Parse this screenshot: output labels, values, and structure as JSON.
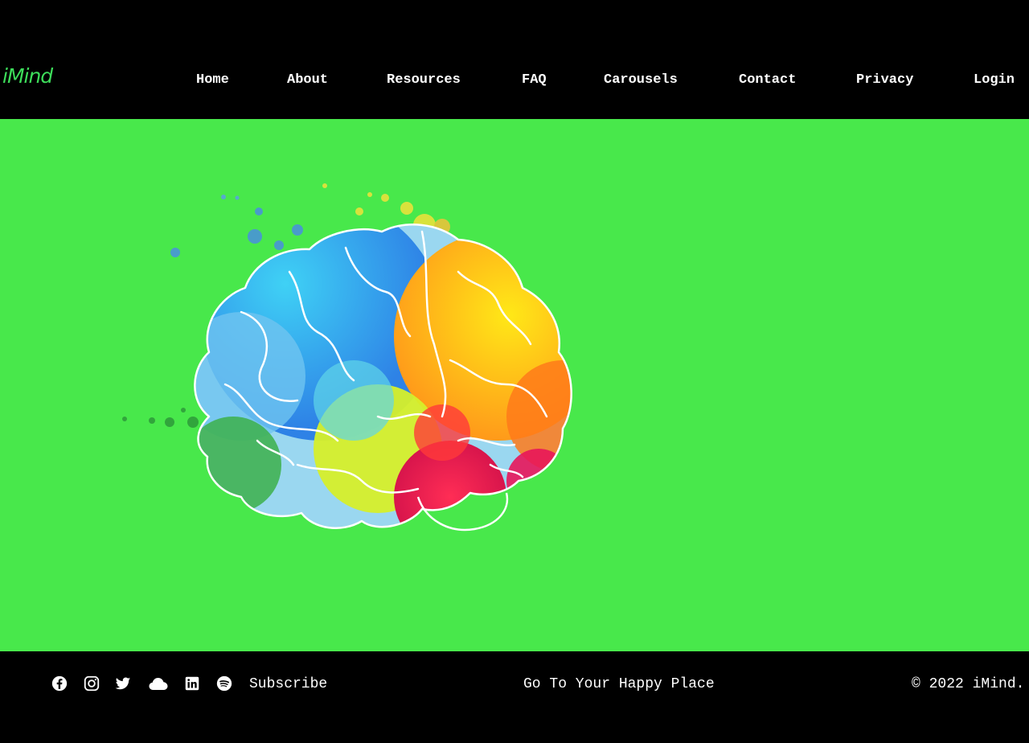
{
  "header": {
    "logo": "iMind",
    "nav": [
      "Home",
      "About",
      "Resources",
      "FAQ",
      "Carousels",
      "Contact",
      "Privacy",
      "Login"
    ]
  },
  "hero": {
    "background_color": "#48e84b",
    "image": "colorful-brain-illustration"
  },
  "footer": {
    "social_icons": [
      "facebook-icon",
      "instagram-icon",
      "twitter-icon",
      "cloud-icon",
      "linkedin-icon",
      "spotify-icon"
    ],
    "subscribe": "Subscribe",
    "tagline": "Go To Your Happy Place",
    "copyright": "© 2022 iMind."
  },
  "colors": {
    "header_bg": "#000000",
    "logo": "#3ddc5a",
    "hero_bg": "#48e84b",
    "footer_bg": "#000000",
    "text": "#ffffff"
  }
}
